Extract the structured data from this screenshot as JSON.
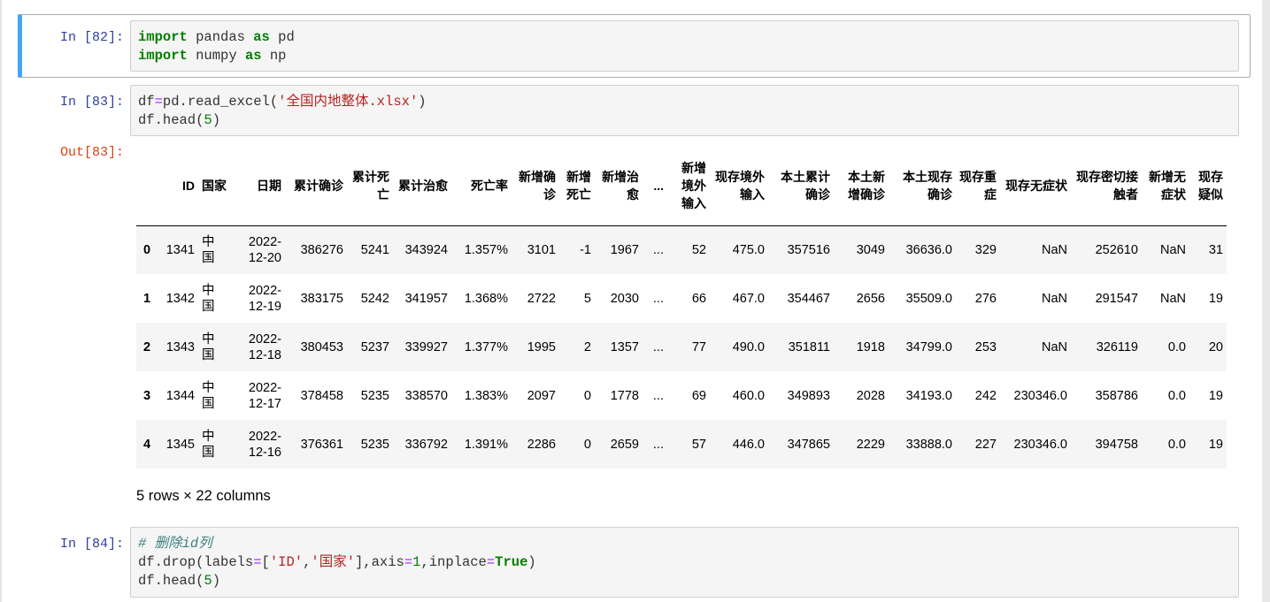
{
  "cells": [
    {
      "prompt": "In  [82]:",
      "lines": [
        [
          {
            "t": "kw",
            "v": "import"
          },
          {
            "t": "",
            "v": " pandas "
          },
          {
            "t": "kw",
            "v": "as"
          },
          {
            "t": "",
            "v": " pd"
          }
        ],
        [
          {
            "t": "kw",
            "v": "import"
          },
          {
            "t": "",
            "v": " numpy "
          },
          {
            "t": "kw",
            "v": "as"
          },
          {
            "t": "",
            "v": " np"
          }
        ]
      ]
    },
    {
      "prompt": "In  [83]:",
      "lines": [
        [
          {
            "t": "",
            "v": "df"
          },
          {
            "t": "op",
            "v": "="
          },
          {
            "t": "",
            "v": "pd.read_excel("
          },
          {
            "t": "str",
            "v": "'全国内地整体.xlsx'"
          },
          {
            "t": "",
            "v": ")"
          }
        ],
        [
          {
            "t": "",
            "v": "df.head("
          },
          {
            "t": "num",
            "v": "5"
          },
          {
            "t": "",
            "v": ")"
          }
        ]
      ]
    },
    {
      "prompt": "In  [84]:",
      "lines": [
        [
          {
            "t": "cm",
            "v": "# 删除id列"
          }
        ],
        [
          {
            "t": "",
            "v": "df.drop(labels"
          },
          {
            "t": "op",
            "v": "="
          },
          {
            "t": "",
            "v": "["
          },
          {
            "t": "str",
            "v": "'ID'"
          },
          {
            "t": "",
            "v": ","
          },
          {
            "t": "str",
            "v": "'国家'"
          },
          {
            "t": "",
            "v": "],axis"
          },
          {
            "t": "op",
            "v": "="
          },
          {
            "t": "num",
            "v": "1"
          },
          {
            "t": "",
            "v": ",inplace"
          },
          {
            "t": "op",
            "v": "="
          },
          {
            "t": "kw",
            "v": "True"
          },
          {
            "t": "",
            "v": ")"
          }
        ],
        [
          {
            "t": "",
            "v": "df.head("
          },
          {
            "t": "num",
            "v": "5"
          },
          {
            "t": "",
            "v": ")"
          }
        ]
      ]
    }
  ],
  "output": {
    "prompt": "Out[83]:",
    "columns": [
      "",
      "ID",
      "国家",
      "日期",
      "累计确诊",
      "累计死亡",
      "累计治愈",
      "死亡率",
      "新增确诊",
      "新增死亡",
      "新增治愈",
      "...",
      "新增境外输入",
      "现存境外输入",
      "本土累计确诊",
      "本土新增确诊",
      "本土现存确诊",
      "现存重症",
      "现存无症状",
      "现存密切接触者",
      "新增无症状",
      "现存疑似"
    ],
    "rows": [
      [
        "0",
        "1341",
        "中国",
        "2022-12-20",
        "386276",
        "5241",
        "343924",
        "1.357%",
        "3101",
        "-1",
        "1967",
        "...",
        "52",
        "475.0",
        "357516",
        "3049",
        "36636.0",
        "329",
        "NaN",
        "252610",
        "NaN",
        "31"
      ],
      [
        "1",
        "1342",
        "中国",
        "2022-12-19",
        "383175",
        "5242",
        "341957",
        "1.368%",
        "2722",
        "5",
        "2030",
        "...",
        "66",
        "467.0",
        "354467",
        "2656",
        "35509.0",
        "276",
        "NaN",
        "291547",
        "NaN",
        "19"
      ],
      [
        "2",
        "1343",
        "中国",
        "2022-12-18",
        "380453",
        "5237",
        "339927",
        "1.377%",
        "1995",
        "2",
        "1357",
        "...",
        "77",
        "490.0",
        "351811",
        "1918",
        "34799.0",
        "253",
        "NaN",
        "326119",
        "0.0",
        "20"
      ],
      [
        "3",
        "1344",
        "中国",
        "2022-12-17",
        "378458",
        "5235",
        "338570",
        "1.383%",
        "2097",
        "0",
        "1778",
        "...",
        "69",
        "460.0",
        "349893",
        "2028",
        "34193.0",
        "242",
        "230346.0",
        "358786",
        "0.0",
        "19"
      ],
      [
        "4",
        "1345",
        "中国",
        "2022-12-16",
        "376361",
        "5235",
        "336792",
        "1.391%",
        "2286",
        "0",
        "2659",
        "...",
        "57",
        "446.0",
        "347865",
        "2229",
        "33888.0",
        "227",
        "230346.0",
        "394758",
        "0.0",
        "19"
      ]
    ],
    "shape_text": "5 rows × 22 columns"
  },
  "colors": {
    "selected_bar": "#42a5f5",
    "in_prompt": "#303f9f",
    "out_prompt": "#d84315",
    "keyword": "#008000",
    "string": "#ba2121",
    "operator": "#aa22ff",
    "comment": "#408080"
  }
}
